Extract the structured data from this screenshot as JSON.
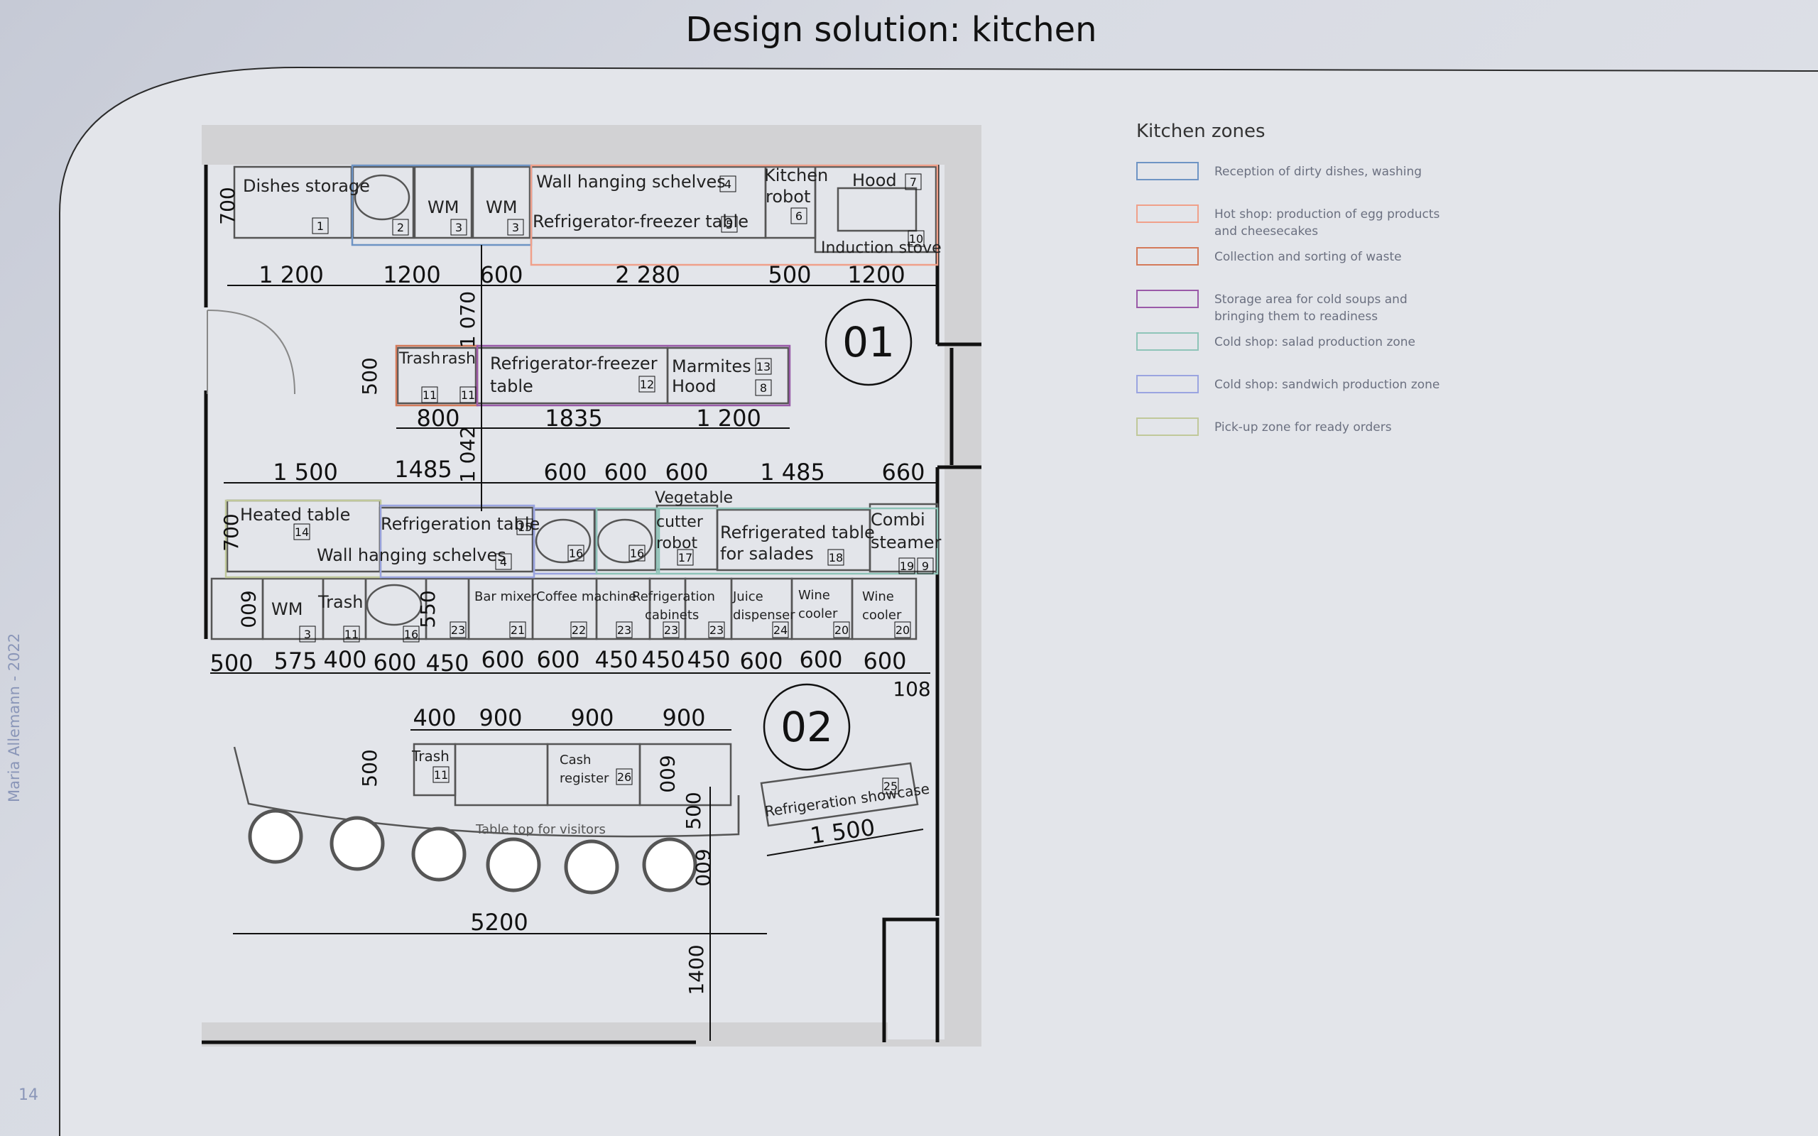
{
  "header": {
    "title": "Design solution: kitchen"
  },
  "footer": {
    "author": "Maria Allemann - 2022",
    "page_number": "14"
  },
  "legend": {
    "title": "Kitchen zones",
    "items": [
      {
        "label": "Reception of dirty dishes, washing",
        "color": "#6e94c4"
      },
      {
        "label": "Hot shop: production of egg products and cheesecakes",
        "color": "#f0a08a"
      },
      {
        "label": "Collection and sorting of waste",
        "color": "#d47a5a"
      },
      {
        "label": "Storage area for cold soups and bringing them to readiness",
        "color": "#9a5aa8"
      },
      {
        "label": "Cold shop: salad production zone",
        "color": "#8ec4b8"
      },
      {
        "label": "Cold shop: sandwich production zone",
        "color": "#9aa4e0"
      },
      {
        "label": "Pick-up zone for ready orders",
        "color": "#c0c89a"
      }
    ]
  },
  "plan": {
    "zones": {
      "z01": "01",
      "z02": "02"
    },
    "labels": {
      "dishes_storage": "Dishes storage",
      "wm": "WM",
      "wall_shelves": "Wall hanging schelves",
      "fridge_table": "Refrigerator-freezer table",
      "kitchen": "Kitchen",
      "robot": "robot",
      "hood": "Hood",
      "induction": "Induction stove",
      "trash": "Trash",
      "rash": "rash",
      "ff1": "Refrigerator-freezer",
      "ff2": "table",
      "marmites": "Marmites",
      "hood2": "Hood",
      "heated_table": "Heated table",
      "refrig_table": "Refrigeration table",
      "vegetable": "Vegetable",
      "cutter": "cutter",
      "robot2": "robot",
      "refrigerated_table": "Refrigerated table",
      "for_salades": "for salades",
      "combi": "Combi",
      "steamer": "steamer",
      "bar_mixer": "Bar mixer",
      "coffee": "Coffee machine",
      "refr_cab1": "Refrigeration",
      "refr_cab2": "cabinets",
      "juice1": "Juice",
      "juice2": "dispenser",
      "wine1": "Wine",
      "wine2": "cooler",
      "cash1": "Cash",
      "cash2": "register",
      "showcase": "Refrigeration showcase",
      "table_top": "Table top for visitors"
    },
    "badges": {
      "b1": "1",
      "b2": "2",
      "b3": "3",
      "b4": "4",
      "b5": "5",
      "b6": "6",
      "b7": "7",
      "b8": "8",
      "b9": "9",
      "b10": "10",
      "b11": "11",
      "b12": "12",
      "b13": "13",
      "b14": "14",
      "b15": "15",
      "b16": "16",
      "b17": "17",
      "b18": "18",
      "b19": "19",
      "b20": "20",
      "b21": "21",
      "b22": "22",
      "b23": "23",
      "b24": "24",
      "b25": "25",
      "b26": "26"
    },
    "dims": {
      "d700": "700",
      "d1200a": "1 200",
      "d1200": "1200",
      "d600": "600",
      "d2280": "2 280",
      "d500": "500",
      "d1070": "1 070",
      "d800": "800",
      "d1835": "1835",
      "d1200b": "1 200",
      "d1500": "1 500",
      "d1485": "1485",
      "d1042": "1 042",
      "d1485b": "1 485",
      "d660": "660",
      "d575": "575",
      "d400": "400",
      "d450": "450",
      "d550": "550",
      "d108": "108",
      "d900": "900",
      "d1500b": "1 500",
      "d5200": "5200",
      "d1400": "1400"
    }
  }
}
